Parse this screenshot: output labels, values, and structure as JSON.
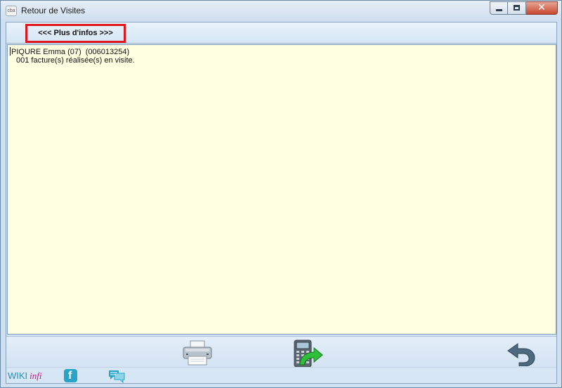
{
  "window": {
    "title": "Retour de Visites",
    "app_icon_text": "cba",
    "close_label": "✕"
  },
  "infobar": {
    "more_info_label": "<<< Plus d'infos >>>"
  },
  "content": {
    "lines": [
      "PIQURE Emma (07)  (006013254)",
      "001 facture(s) réalisée(s) en visite."
    ]
  },
  "toolbar": {
    "icons": [
      "printer-icon",
      "terminal-transfer-icon",
      "undo-arrow-icon"
    ]
  },
  "footer": {
    "wiki_part1": "WIKI",
    "wiki_part2": "infi",
    "facebook_letter": "f",
    "colors": {
      "wiki_blue": "#2a8fb3",
      "wiki_magenta": "#c2187a",
      "facebook_bg": "#2aa4c6",
      "highlight_red": "#e0161e",
      "textarea_bg": "#ffffe2"
    }
  }
}
